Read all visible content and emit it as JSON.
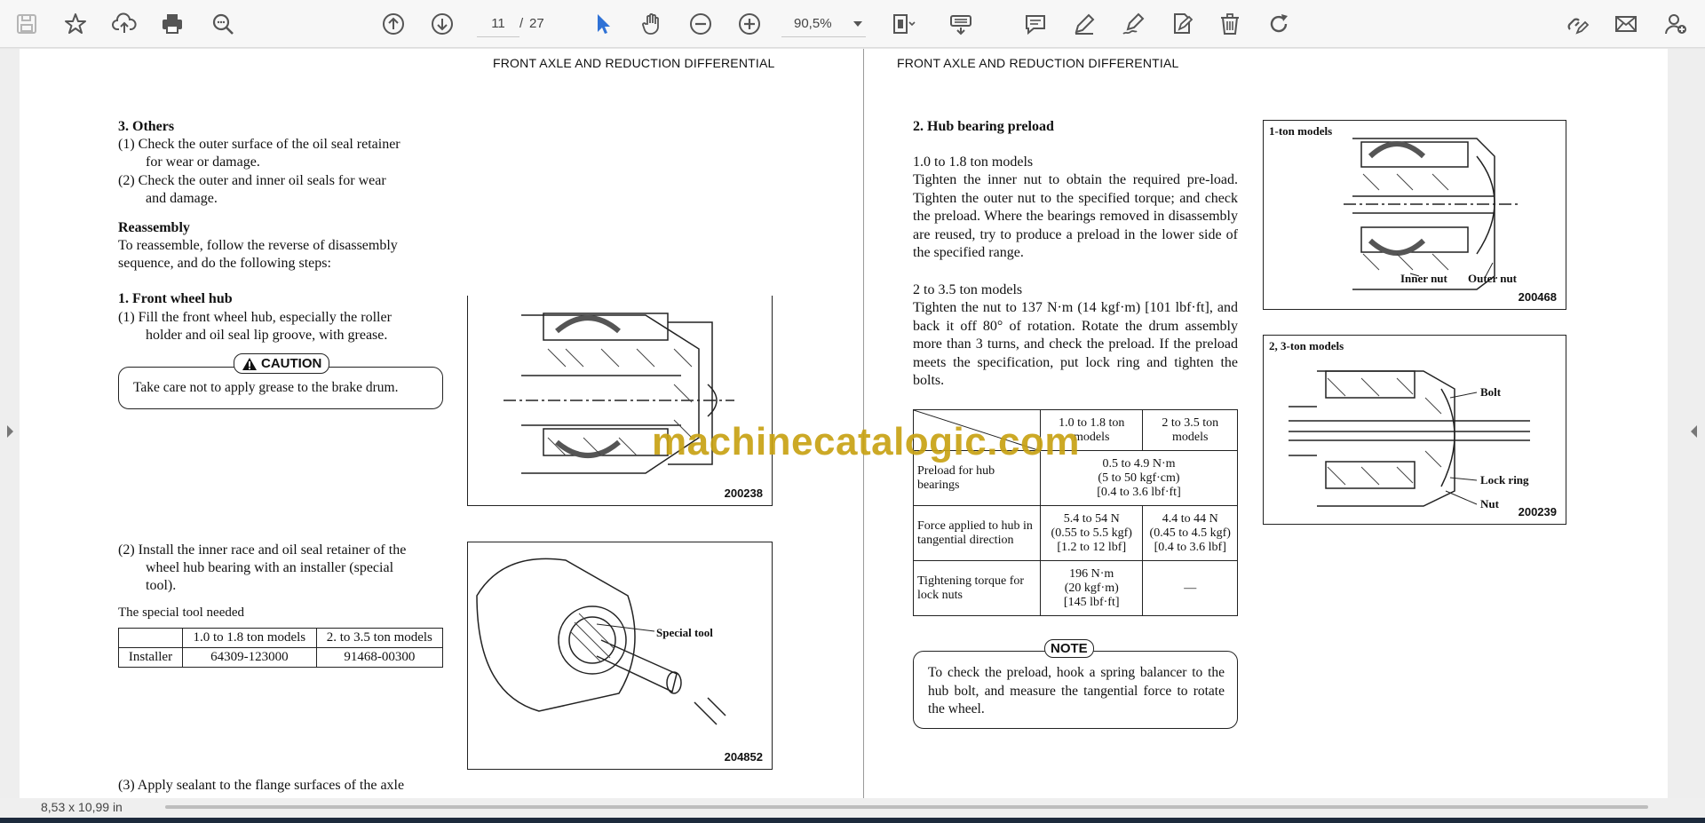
{
  "toolbar": {
    "page_current": "11",
    "page_separator": "/",
    "page_total": "27",
    "zoom": "90,5%"
  },
  "status": {
    "page_size": "8,53 x 10,99 in"
  },
  "watermark": "machinecatalogic.com",
  "left_page": {
    "running_head": "FRONT AXLE AND REDUCTION DIFFERENTIAL",
    "others_heading": "3.   Others",
    "others_1": "(1)  Check the outer surface of the oil seal retainer",
    "others_1b": "for wear or damage.",
    "others_2": "(2)  Check the outer and inner oil seals for wear",
    "others_2b": "and damage.",
    "reassembly_heading": "Reassembly",
    "reassembly_text_1": "To reassemble, follow the reverse of disassembly",
    "reassembly_text_2": "sequence, and do the following steps:",
    "front_hub_heading": "1.   Front wheel hub",
    "front_hub_1": "(1)  Fill the front wheel hub, especially the roller",
    "front_hub_1b": "holder and oil seal lip groove, with grease.",
    "caution_label": "CAUTION",
    "caution_text": "Take care not to apply grease to the brake drum.",
    "fig1_number": "200238",
    "install_2": "(2)  Install the inner race and oil seal retainer of the",
    "install_2b": "wheel hub bearing with an installer (special",
    "install_2c": "tool).",
    "special_tool_needed": "The special tool needed",
    "tool_table": {
      "headers": [
        "",
        "1.0 to 1.8 ton models",
        "2. to 3.5 ton models"
      ],
      "row": [
        "Installer",
        "64309-123000",
        "91468-00300"
      ]
    },
    "fig2_label": "Special tool",
    "fig2_number": "204852",
    "sealant_3": "(3)  Apply sealant to the flange surfaces of the axle"
  },
  "right_page": {
    "running_head": "FRONT AXLE AND REDUCTION DIFFERENTIAL",
    "preload_heading": "2.   Hub bearing preload",
    "small_models_title": "1.0 to 1.8 ton models",
    "small_models_text": "Tighten the inner nut to obtain the required pre-load. Tighten the outer nut to the specified torque; and check the preload. Where the bearings removed in disassembly are reused, try to produce a preload in the lower side of the specified range.",
    "large_models_title": "2 to 3.5 ton models",
    "large_models_text": "Tighten the nut to 137 N·m (14 kgf·m) [101 lbf·ft], and back it off 80° of rotation. Rotate the drum assembly more than 3 turns, and check the preload. If the preload meets the specification, put lock ring and tighten the bolts.",
    "spec_table": {
      "col1": "1.0 to 1.8 ton models",
      "col2": "2 to 3.5 ton models",
      "rows": [
        {
          "label": "Preload for hub bearings",
          "merged": "0.5 to 4.9 N·m\n(5 to 50 kgf·cm)\n[0.4 to 3.6 lbf·ft]"
        },
        {
          "label": "Force applied to hub in tangential direction",
          "a": "5.4 to 54 N\n(0.55 to 5.5 kgf)\n[1.2 to 12 lbf]",
          "b": "4.4 to 44 N\n(0.45 to 4.5 kgf)\n[0.4 to 3.6 lbf]"
        },
        {
          "label": "Tightening torque for lock nuts",
          "a": "196 N·m\n(20 kgf·m)\n[145 lbf·ft]",
          "b": "—"
        }
      ]
    },
    "note_label": "NOTE",
    "note_text": "To check the preload, hook a spring balancer to the hub bolt, and measure the tangential force to rotate the wheel.",
    "fig3_caption": "1-ton models",
    "fig3_inner": "Inner nut",
    "fig3_outer": "Outer nut",
    "fig3_number": "200468",
    "fig4_caption": "2, 3-ton models",
    "fig4_bolt": "Bolt",
    "fig4_lockring": "Lock ring",
    "fig4_nut": "Nut",
    "fig4_number": "200239"
  }
}
